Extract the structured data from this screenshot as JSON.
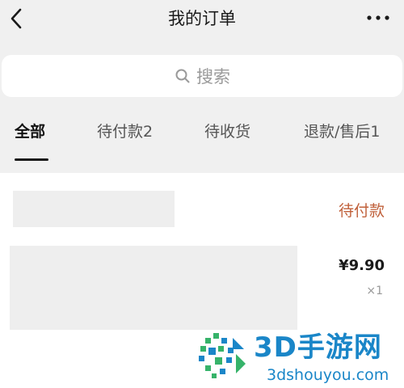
{
  "header": {
    "title": "我的订单",
    "back_icon": "chevron-left-icon",
    "more_icon": "more-horizontal-icon"
  },
  "search": {
    "placeholder": "搜索",
    "icon": "search-icon"
  },
  "tabs": [
    {
      "label": "全部",
      "active": true
    },
    {
      "label": "待付款2",
      "active": false
    },
    {
      "label": "待收货",
      "active": false
    },
    {
      "label": "退款/售后1",
      "active": false
    }
  ],
  "order": {
    "status": "待付款",
    "price": "¥9.90",
    "quantity": "×1"
  },
  "watermark": {
    "name": "3D手游网",
    "url": "3dshouyou.com"
  },
  "colors": {
    "status": "#c0603a",
    "watermark": "#1a86c8",
    "watermark_green": "#36b36a",
    "background": "#f0f0f0"
  }
}
